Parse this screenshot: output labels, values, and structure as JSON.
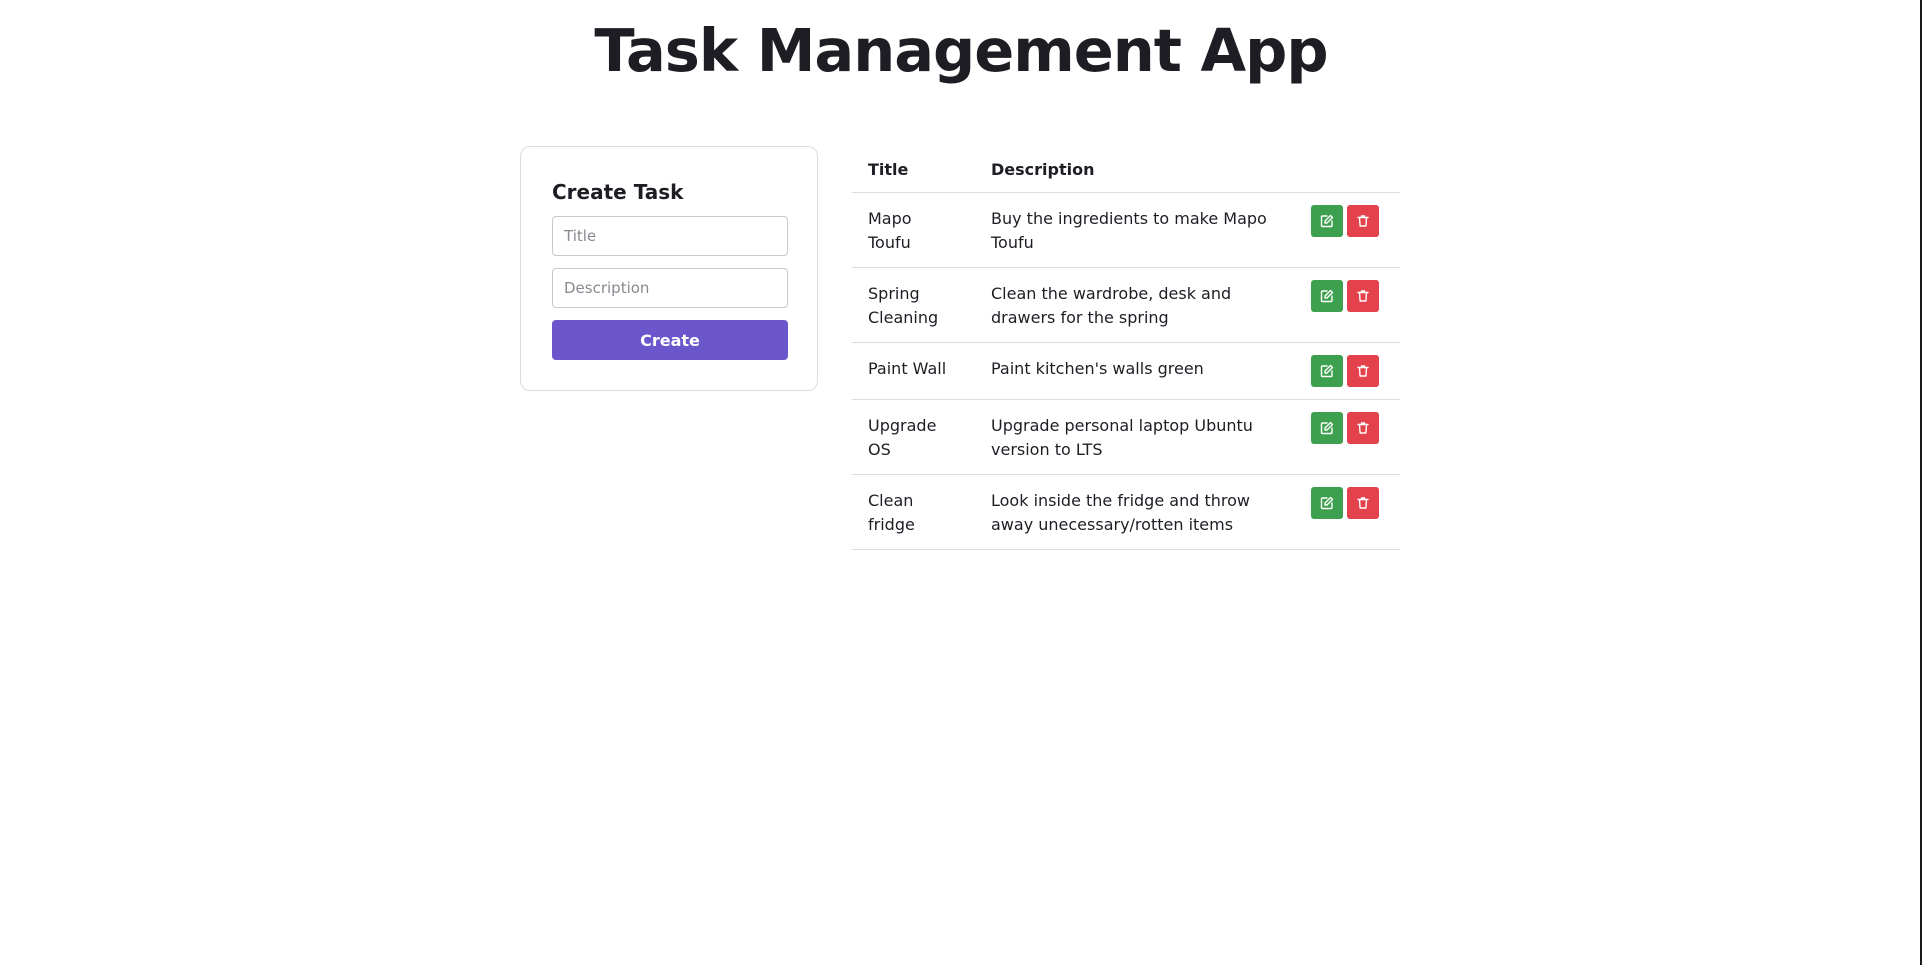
{
  "header": {
    "title": "Task Management App"
  },
  "create_form": {
    "heading": "Create Task",
    "title_placeholder": "Title",
    "description_placeholder": "Description",
    "submit_label": "Create"
  },
  "table": {
    "columns": [
      "Title",
      "Description"
    ],
    "rows": [
      {
        "title": "Mapo Toufu",
        "description": "Buy the ingredients to make Mapo Toufu"
      },
      {
        "title": "Spring Cleaning",
        "description": "Clean the wardrobe, desk and drawers for the spring"
      },
      {
        "title": "Paint Wall",
        "description": "Paint kitchen's walls green"
      },
      {
        "title": "Upgrade OS",
        "description": "Upgrade personal laptop Ubuntu version to LTS"
      },
      {
        "title": "Clean fridge",
        "description": "Look inside the fridge and throw away unecessary/rotten items"
      }
    ],
    "row_actions": [
      {
        "name": "edit",
        "icon": "edit-icon",
        "color": "#3da04f"
      },
      {
        "name": "delete",
        "icon": "trash-icon",
        "color": "#e3414b"
      }
    ]
  },
  "colors": {
    "accent": "#6b56cc",
    "edit": "#3da04f",
    "delete": "#e3414b"
  }
}
